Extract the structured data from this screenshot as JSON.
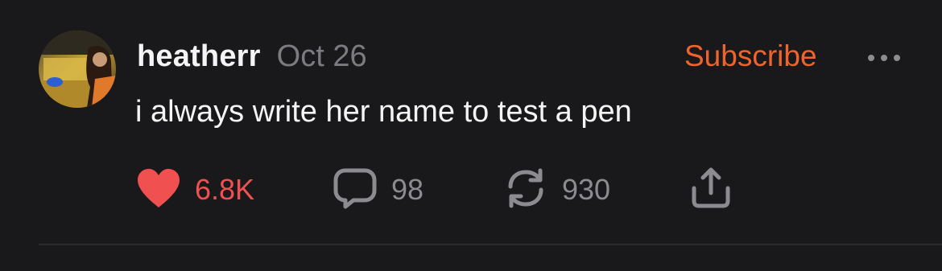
{
  "post": {
    "username": "heatherr",
    "date": "Oct 26",
    "subscribe_label": "Subscribe",
    "text": "i always write her name to test a pen",
    "likes": "6.8K",
    "comments": "98",
    "reposts": "930",
    "liked": true
  },
  "icons": {
    "more": "more-horizontal-icon",
    "like": "heart-icon",
    "comment": "comment-bubble-icon",
    "repost": "repost-icon",
    "share": "share-icon"
  },
  "colors": {
    "background": "#19191b",
    "accent": "#f0642b",
    "like": "#f0504f",
    "muted": "#7b7b80"
  }
}
